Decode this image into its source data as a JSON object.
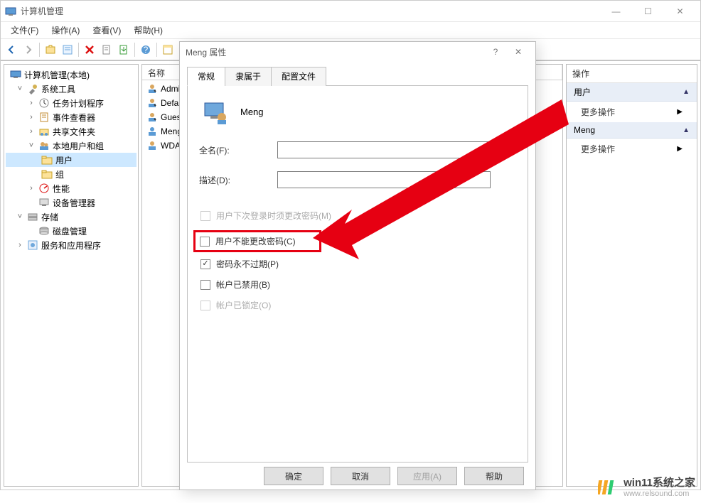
{
  "window": {
    "title": "计算机管理",
    "controls": {
      "minimize": "—",
      "maximize": "☐",
      "close": "✕"
    }
  },
  "menu": [
    {
      "label": "文件(F)"
    },
    {
      "label": "操作(A)"
    },
    {
      "label": "查看(V)"
    },
    {
      "label": "帮助(H)"
    }
  ],
  "tree": {
    "root": "计算机管理(本地)",
    "system_tools": "系统工具",
    "task_scheduler": "任务计划程序",
    "event_viewer": "事件查看器",
    "shared_folders": "共享文件夹",
    "local_users_groups": "本地用户和组",
    "users": "用户",
    "groups": "组",
    "performance": "性能",
    "device_manager": "设备管理器",
    "storage": "存储",
    "disk_management": "磁盘管理",
    "services_apps": "服务和应用程序"
  },
  "list": {
    "header_name": "名称",
    "rows": [
      {
        "name": "Admi"
      },
      {
        "name": "Defa"
      },
      {
        "name": "Gues"
      },
      {
        "name": "Meng"
      },
      {
        "name": "WDA"
      }
    ]
  },
  "actions": {
    "title": "操作",
    "sections": [
      {
        "header": "用户",
        "items": [
          "更多操作"
        ]
      },
      {
        "header": "Meng",
        "items": [
          "更多操作"
        ]
      }
    ]
  },
  "dialog": {
    "title": "Meng 属性",
    "tabs": [
      "常规",
      "隶属于",
      "配置文件"
    ],
    "user_name": "Meng",
    "fullname_label": "全名(F):",
    "fullname_value": "",
    "description_label": "描述(D):",
    "description_value": "",
    "checkboxes": {
      "must_change": "用户下次登录时须更改密码(M)",
      "cannot_change": "用户不能更改密码(C)",
      "never_expires": "密码永不过期(P)",
      "disabled": "帐户已禁用(B)",
      "locked": "帐户已锁定(O)"
    },
    "buttons": {
      "ok": "确定",
      "cancel": "取消",
      "apply": "应用(A)",
      "help": "帮助"
    }
  },
  "watermark": {
    "line1": "win11系统之家",
    "line2": "www.relsound.com"
  }
}
